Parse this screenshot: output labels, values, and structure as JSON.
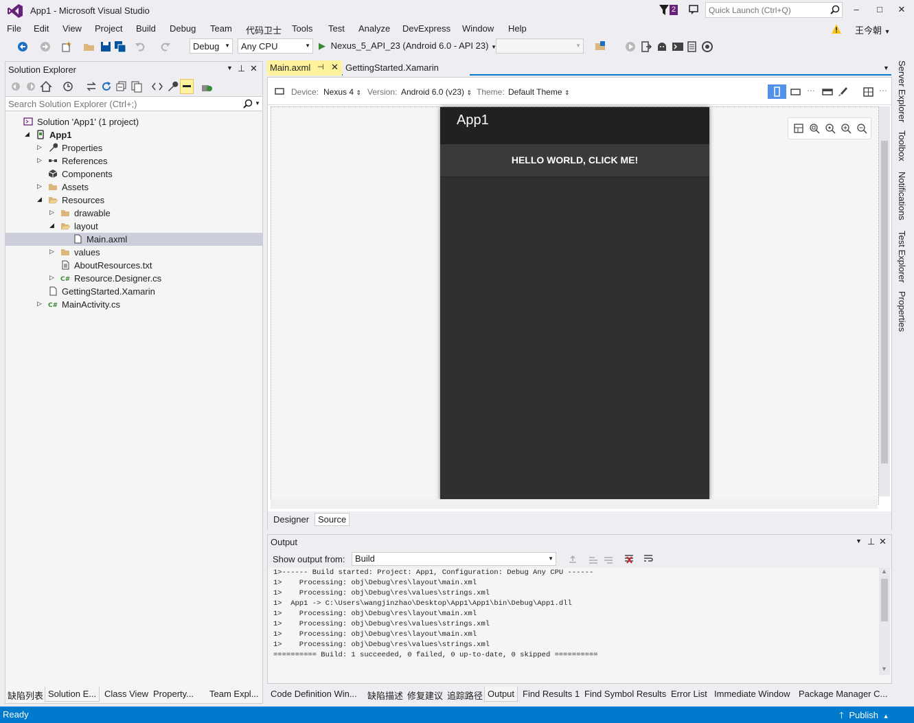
{
  "title": "App1 - Microsoft Visual Studio",
  "notification_count": "2",
  "quick_launch_placeholder": "Quick Launch (Ctrl+Q)",
  "window_buttons": [
    "–",
    "□",
    "✕"
  ],
  "menu": [
    "File",
    "Edit",
    "View",
    "Project",
    "Build",
    "Debug",
    "Team",
    "代码卫士",
    "Tools",
    "Test",
    "Analyze",
    "DevExpress",
    "Window",
    "Help"
  ],
  "user_name": "王今朝",
  "toolbar": {
    "config": "Debug",
    "platform": "Any CPU",
    "run_target": "Nexus_5_API_23 (Android 6.0 - API 23)"
  },
  "solution_explorer": {
    "title": "Solution Explorer",
    "search_placeholder": "Search Solution Explorer (Ctrl+;)",
    "tree": [
      {
        "label": "Solution 'App1' (1 project)",
        "indent": 0,
        "toggle": "",
        "icon": "solution-icon",
        "bold": false
      },
      {
        "label": "App1",
        "indent": 1,
        "toggle": "◢",
        "icon": "android-project-icon",
        "bold": true
      },
      {
        "label": "Properties",
        "indent": 2,
        "toggle": "▷",
        "icon": "wrench-icon",
        "bold": false
      },
      {
        "label": "References",
        "indent": 2,
        "toggle": "▷",
        "icon": "references-icon",
        "bold": false
      },
      {
        "label": "Components",
        "indent": 2,
        "toggle": "",
        "icon": "components-icon",
        "bold": false
      },
      {
        "label": "Assets",
        "indent": 2,
        "toggle": "▷",
        "icon": "folder-icon",
        "bold": false
      },
      {
        "label": "Resources",
        "indent": 2,
        "toggle": "◢",
        "icon": "folder-open-icon",
        "bold": false
      },
      {
        "label": "drawable",
        "indent": 3,
        "toggle": "▷",
        "icon": "folder-icon",
        "bold": false
      },
      {
        "label": "layout",
        "indent": 3,
        "toggle": "◢",
        "icon": "folder-open-icon",
        "bold": false
      },
      {
        "label": "Main.axml",
        "indent": 4,
        "toggle": "",
        "icon": "file-icon",
        "bold": false,
        "selected": true
      },
      {
        "label": "values",
        "indent": 3,
        "toggle": "▷",
        "icon": "folder-icon",
        "bold": false
      },
      {
        "label": "AboutResources.txt",
        "indent": 3,
        "toggle": "",
        "icon": "text-file-icon",
        "bold": false
      },
      {
        "label": "Resource.Designer.cs",
        "indent": 3,
        "toggle": "▷",
        "icon": "csharp-file-icon",
        "bold": false
      },
      {
        "label": "GettingStarted.Xamarin",
        "indent": 2,
        "toggle": "",
        "icon": "file-icon",
        "bold": false
      },
      {
        "label": "MainActivity.cs",
        "indent": 2,
        "toggle": "▷",
        "icon": "csharp-file-icon",
        "bold": false
      }
    ]
  },
  "left_bottom_tabs": [
    "缺陷列表",
    "Solution E...",
    "Class View",
    "Property...",
    "Team Expl..."
  ],
  "doc_tabs": [
    {
      "label": "Main.axml",
      "active": true
    },
    {
      "label": "GettingStarted.Xamarin",
      "active": false
    }
  ],
  "designer": {
    "device_label": "Device:",
    "device": "Nexus 4",
    "version_label": "Version:",
    "version": "Android 6.0 (v23)",
    "theme_label": "Theme:",
    "theme": "Default Theme",
    "app_title": "App1",
    "button_text": "HELLO WORLD, CLICK ME!",
    "bottom_tabs": [
      "Designer",
      "Source"
    ]
  },
  "output": {
    "title": "Output",
    "show_from_label": "Show output from:",
    "show_from_value": "Build",
    "lines": [
      "1>------ Build started: Project: App1, Configuration: Debug Any CPU ------",
      "1>    Processing: obj\\Debug\\res\\layout\\main.xml",
      "1>    Processing: obj\\Debug\\res\\values\\strings.xml",
      "1>  App1 -> C:\\Users\\wangjinzhao\\Desktop\\App1\\App1\\bin\\Debug\\App1.dll",
      "1>    Processing: obj\\Debug\\res\\layout\\main.xml",
      "1>    Processing: obj\\Debug\\res\\values\\strings.xml",
      "1>    Processing: obj\\Debug\\res\\layout\\main.xml",
      "1>    Processing: obj\\Debug\\res\\values\\strings.xml",
      "========== Build: 1 succeeded, 0 failed, 0 up-to-date, 0 skipped =========="
    ]
  },
  "bottom_tabs": [
    "Code Definition Win...",
    "缺陷描述",
    "修复建议",
    "追踪路径",
    "Output",
    "Find Results 1",
    "Find Symbol Results",
    "Error List",
    "Immediate Window",
    "Package Manager C..."
  ],
  "right_tabs": [
    "Server Explorer",
    "Toolbox",
    "Notifications",
    "Test Explorer",
    "Properties"
  ],
  "status": {
    "left": "Ready",
    "right": "Publish"
  },
  "colors": {
    "accent": "#007acc",
    "vs_purple": "#68217a",
    "active_tab": "#fff29d"
  }
}
